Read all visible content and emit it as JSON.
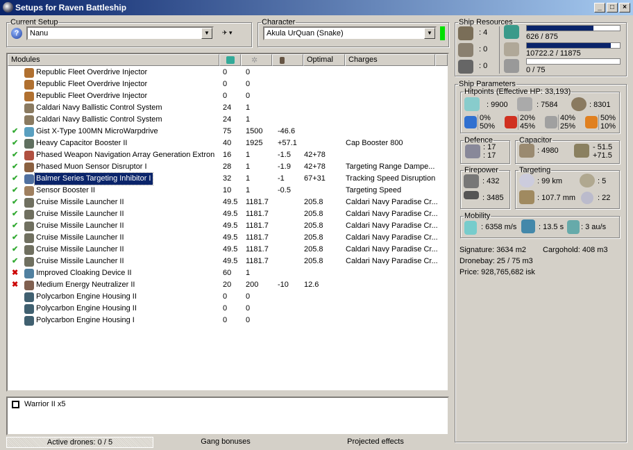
{
  "window": {
    "title": "Setups for Raven Battleship",
    "min": "_",
    "max": "□",
    "close": "×"
  },
  "setup": {
    "legend": "Current Setup",
    "value": "Nanu"
  },
  "character": {
    "legend": "Character",
    "value": "Akula UrQuan (Snake)",
    "status_color": "#00e000"
  },
  "columns": [
    "Modules",
    "",
    "",
    "",
    "Optimal",
    "Charges"
  ],
  "modules": [
    {
      "status": "",
      "name": "Republic Fleet Overdrive Injector",
      "cpu": "0",
      "pg": "0",
      "cap": "",
      "optimal": "",
      "charges": "",
      "color": "#b07030"
    },
    {
      "status": "",
      "name": "Republic Fleet Overdrive Injector",
      "cpu": "0",
      "pg": "0",
      "cap": "",
      "optimal": "",
      "charges": "",
      "color": "#b07030"
    },
    {
      "status": "",
      "name": "Republic Fleet Overdrive Injector",
      "cpu": "0",
      "pg": "0",
      "cap": "",
      "optimal": "",
      "charges": "",
      "color": "#b07030"
    },
    {
      "status": "",
      "name": "Caldari Navy Ballistic Control System",
      "cpu": "24",
      "pg": "1",
      "cap": "",
      "optimal": "",
      "charges": "",
      "color": "#8a7a60"
    },
    {
      "status": "",
      "name": "Caldari Navy Ballistic Control System",
      "cpu": "24",
      "pg": "1",
      "cap": "",
      "optimal": "",
      "charges": "",
      "color": "#8a7a60"
    },
    {
      "status": "on",
      "name": "Gist X-Type 100MN MicroWarpdrive",
      "cpu": "75",
      "pg": "1500",
      "cap": "-46.6",
      "optimal": "",
      "charges": "",
      "color": "#5aa0c0"
    },
    {
      "status": "on",
      "name": "Heavy Capacitor Booster II",
      "cpu": "40",
      "pg": "1925",
      "cap": "+57.1",
      "optimal": "",
      "charges": "Cap Booster 800",
      "color": "#607060"
    },
    {
      "status": "on",
      "name": "Phased Weapon Navigation Array Generation Extron",
      "cpu": "16",
      "pg": "1",
      "cap": "-1.5",
      "optimal": "42+78",
      "charges": "",
      "color": "#b05040"
    },
    {
      "status": "on",
      "name": "Phased Muon Sensor Disruptor I",
      "cpu": "28",
      "pg": "1",
      "cap": "-1.9",
      "optimal": "42+78",
      "charges": "Targeting Range Dampe...",
      "color": "#8a6040"
    },
    {
      "status": "on",
      "name": "Balmer Series Targeting Inhibitor I",
      "cpu": "32",
      "pg": "1",
      "cap": "-1",
      "optimal": "67+31",
      "charges": "Tracking Speed Disruption",
      "color": "#5070a0",
      "selected": true
    },
    {
      "status": "on",
      "name": "Sensor Booster II",
      "cpu": "10",
      "pg": "1",
      "cap": "-0.5",
      "optimal": "",
      "charges": "Targeting Speed",
      "color": "#a08060"
    },
    {
      "status": "on",
      "name": "Cruise Missile Launcher II",
      "cpu": "49.5",
      "pg": "1181.7",
      "cap": "",
      "optimal": "205.8",
      "charges": "Caldari Navy Paradise Cr...",
      "color": "#707060"
    },
    {
      "status": "on",
      "name": "Cruise Missile Launcher II",
      "cpu": "49.5",
      "pg": "1181.7",
      "cap": "",
      "optimal": "205.8",
      "charges": "Caldari Navy Paradise Cr...",
      "color": "#707060"
    },
    {
      "status": "on",
      "name": "Cruise Missile Launcher II",
      "cpu": "49.5",
      "pg": "1181.7",
      "cap": "",
      "optimal": "205.8",
      "charges": "Caldari Navy Paradise Cr...",
      "color": "#707060"
    },
    {
      "status": "on",
      "name": "Cruise Missile Launcher II",
      "cpu": "49.5",
      "pg": "1181.7",
      "cap": "",
      "optimal": "205.8",
      "charges": "Caldari Navy Paradise Cr...",
      "color": "#707060"
    },
    {
      "status": "on",
      "name": "Cruise Missile Launcher II",
      "cpu": "49.5",
      "pg": "1181.7",
      "cap": "",
      "optimal": "205.8",
      "charges": "Caldari Navy Paradise Cr...",
      "color": "#707060"
    },
    {
      "status": "on",
      "name": "Cruise Missile Launcher II",
      "cpu": "49.5",
      "pg": "1181.7",
      "cap": "",
      "optimal": "205.8",
      "charges": "Caldari Navy Paradise Cr...",
      "color": "#707060"
    },
    {
      "status": "off",
      "name": "Improved Cloaking Device II",
      "cpu": "60",
      "pg": "1",
      "cap": "",
      "optimal": "",
      "charges": "",
      "color": "#5080a0"
    },
    {
      "status": "off",
      "name": "Medium Energy Neutralizer II",
      "cpu": "20",
      "pg": "200",
      "cap": "-10",
      "optimal": "12.6",
      "charges": "",
      "color": "#806050"
    },
    {
      "status": "",
      "name": "Polycarbon Engine Housing II",
      "cpu": "0",
      "pg": "0",
      "cap": "",
      "optimal": "",
      "charges": "",
      "color": "#406070"
    },
    {
      "status": "",
      "name": "Polycarbon Engine Housing II",
      "cpu": "0",
      "pg": "0",
      "cap": "",
      "optimal": "",
      "charges": "",
      "color": "#406070"
    },
    {
      "status": "",
      "name": "Polycarbon Engine Housing I",
      "cpu": "0",
      "pg": "0",
      "cap": "",
      "optimal": "",
      "charges": "",
      "color": "#406070"
    }
  ],
  "drones": [
    {
      "label": "Warrior II x5",
      "checked": false
    }
  ],
  "tabs": {
    "active_drones": "Active drones: 0 / 5",
    "gang": "Gang bonuses",
    "projected": "Projected effects"
  },
  "resources": {
    "legend": "Ship Resources",
    "turrets": ": 4",
    "launchers": ": 0",
    "calibration": ": 0",
    "cpu": "626 / 875",
    "cpu_frac": 0.716,
    "pg": "10722.2 / 11875",
    "pg_frac": 0.903,
    "drone_bw": "0 / 75",
    "drone_frac": 0
  },
  "params": {
    "legend": "Ship Parameters",
    "hp": {
      "legend": "Hitpoints (Effective HP: 33,193)",
      "shield": ": 9900",
      "armor": ": 7584",
      "structure": ": 8301",
      "resists": [
        {
          "a": "0%",
          "b": "50%",
          "color": "#3070d0"
        },
        {
          "a": "20%",
          "b": "45%",
          "color": "#d03020"
        },
        {
          "a": "40%",
          "b": "25%",
          "color": "#a0a0a0"
        },
        {
          "a": "50%",
          "b": "10%",
          "color": "#e08020"
        }
      ]
    },
    "defence": {
      "legend": "Defence",
      "a": ": 17",
      "b": ": 17"
    },
    "capacitor": {
      "legend": "Capacitor",
      "capacity": ": 4980",
      "use": "- 51.5",
      "regen": "+71.5"
    },
    "firepower": {
      "legend": "Firepower",
      "volley": ": 432",
      "dps": ": 3485"
    },
    "targeting": {
      "legend": "Targeting",
      "range": ": 99 km",
      "max_targets": ": 5",
      "scan_res": ": 107.7 mm",
      "sensor": ": 22"
    },
    "mobility": {
      "legend": "Mobility",
      "speed": ": 6358 m/s",
      "align": ": 13.5 s",
      "warp": ": 3 au/s"
    },
    "signature": "Signature: 3634 m2",
    "cargo": "Cargohold: 408 m3",
    "dronebay": "Dronebay: 25 / 75 m3",
    "price": "Price: 928,765,682 isk"
  }
}
